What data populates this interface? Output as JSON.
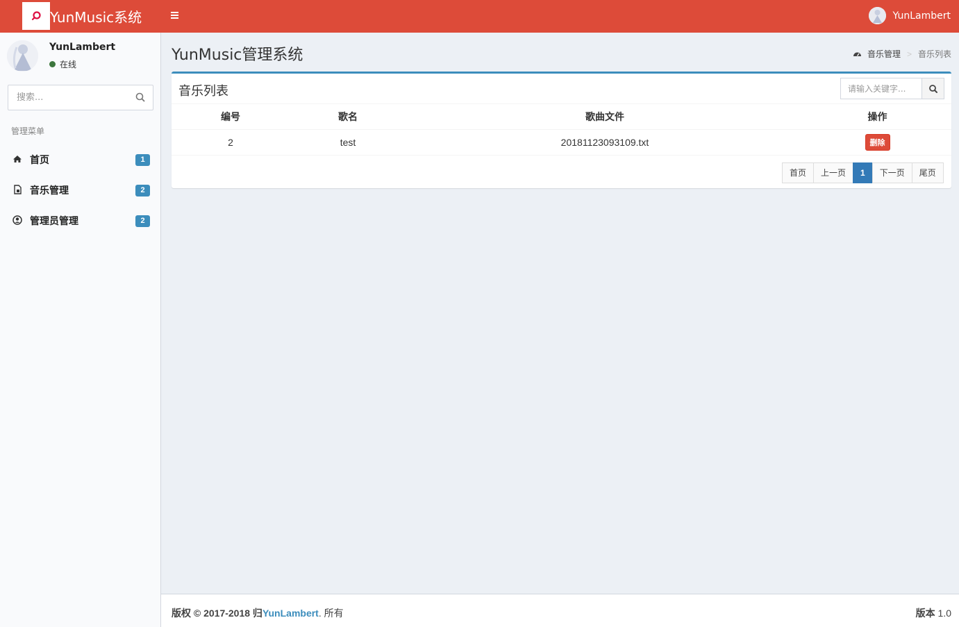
{
  "header": {
    "app_title": "YunMusic系统",
    "user_name": "YunLambert",
    "brand_color": "#dd4b39"
  },
  "sidebar": {
    "user_name": "YunLambert",
    "status": "在线",
    "search_placeholder": "搜索...",
    "menu_header": "管理菜单",
    "items": [
      {
        "icon": "home-icon",
        "label": "首页",
        "badge": "1"
      },
      {
        "icon": "file-icon",
        "label": "音乐管理",
        "badge": "2"
      },
      {
        "icon": "user-circle-icon",
        "label": "管理员管理",
        "badge": "2"
      }
    ]
  },
  "content": {
    "page_title": "YunMusic管理系统",
    "breadcrumb": {
      "parent": "音乐管理",
      "current": "音乐列表"
    },
    "box": {
      "title": "音乐列表",
      "search_placeholder": "请输入关键字...",
      "columns": [
        "编号",
        "歌名",
        "歌曲文件",
        "操作"
      ],
      "rows": [
        {
          "id": "2",
          "name": "test",
          "file": "20181123093109.txt",
          "action": "删除"
        }
      ],
      "pagination": [
        "首页",
        "上一页",
        "1",
        "下一页",
        "尾页"
      ],
      "current_page": "1"
    }
  },
  "footer": {
    "copyright_prefix": "版权 © 2017-2018 归",
    "copyright_link": "YunLambert",
    "copyright_suffix": ". 所有",
    "version_label": "版本",
    "version_value": "1.0"
  }
}
